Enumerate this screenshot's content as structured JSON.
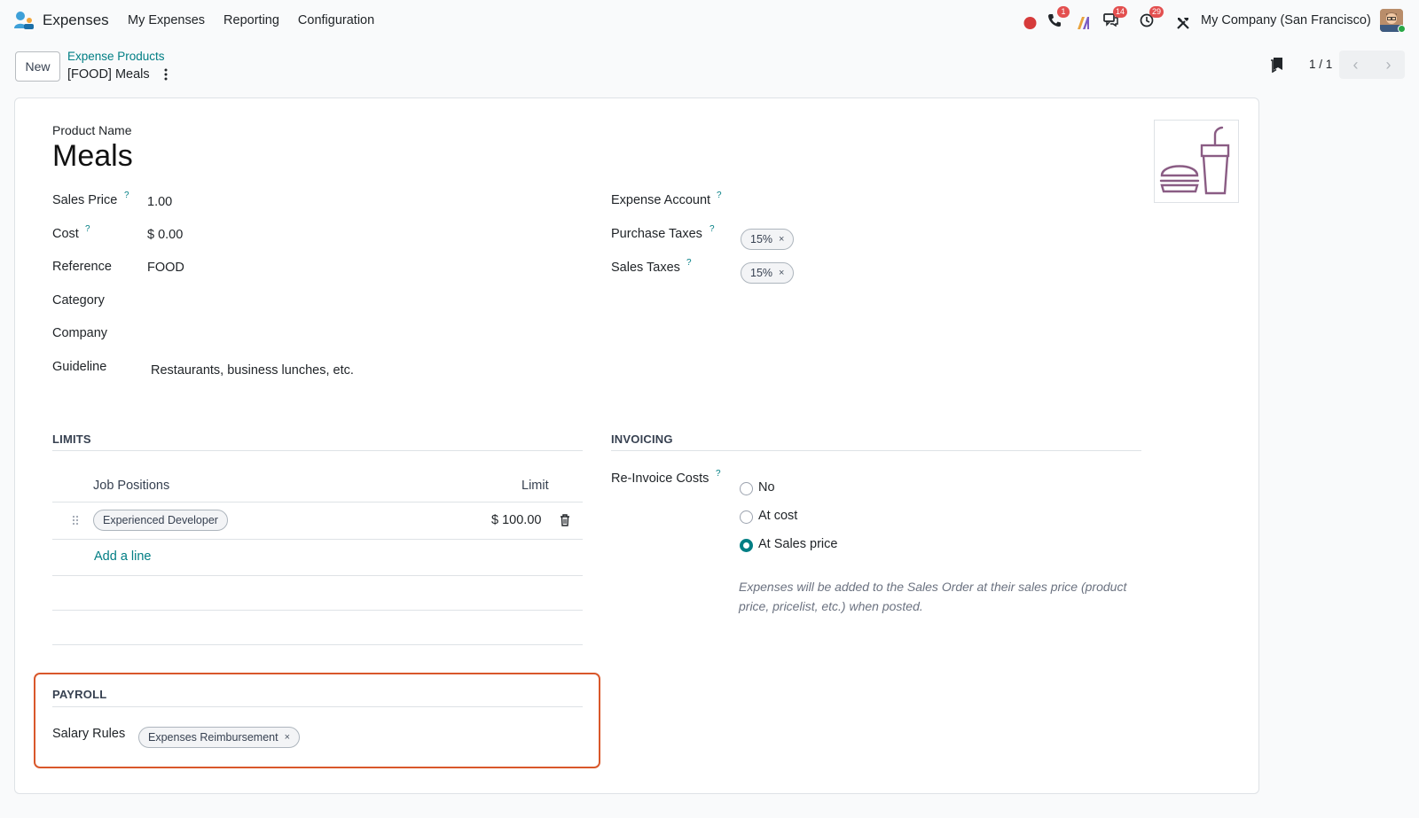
{
  "navbar": {
    "app_name": "Expenses",
    "menu": [
      "My Expenses",
      "Reporting",
      "Configuration"
    ],
    "badges": {
      "calls": "1",
      "messages": "14",
      "activities": "29"
    },
    "company": "My Company (San Francisco)"
  },
  "control_panel": {
    "new_label": "New",
    "breadcrumb_parent": "Expense Products",
    "breadcrumb_current": "[FOOD] Meals",
    "pager_value": "1 / 1"
  },
  "form": {
    "product_name_label": "Product Name",
    "product_name": "Meals",
    "left_fields": [
      {
        "label": "Sales Price",
        "help": "?",
        "value": "1.00"
      },
      {
        "label": "Cost",
        "help": "?",
        "value": "$ 0.00"
      },
      {
        "label": "Reference",
        "help": "",
        "value": "FOOD"
      },
      {
        "label": "Category",
        "help": "",
        "value": ""
      },
      {
        "label": "Company",
        "help": "",
        "value": ""
      },
      {
        "label": "Guideline",
        "help": "",
        "value": "Restaurants, business lunches, etc."
      }
    ],
    "expense_account_label": "Expense Account",
    "purchase_taxes_label": "Purchase Taxes",
    "purchase_taxes_tag": "15%",
    "sales_taxes_label": "Sales Taxes",
    "sales_taxes_tag": "15%",
    "help": "?",
    "tag_remove": "×"
  },
  "limits": {
    "title": "LIMITS",
    "col_job": "Job Positions",
    "col_limit": "Limit",
    "rows": [
      {
        "job": "Experienced Developer",
        "limit": "$ 100.00"
      }
    ],
    "add_line": "Add a line"
  },
  "invoicing": {
    "title": "INVOICING",
    "reinvoice_label": "Re-Invoice Costs",
    "options": [
      "No",
      "At cost",
      "At Sales price"
    ],
    "selected": "At Sales price",
    "note": "Expenses will be added to the Sales Order at their sales price (product price, pricelist, etc.) when posted."
  },
  "payroll": {
    "title": "PAYROLL",
    "salary_rules_label": "Salary Rules",
    "salary_rule_tag": "Expenses Reimbursement"
  },
  "colors": {
    "accent": "#017e84",
    "highlight": "#d9582b",
    "badge": "#e34f4f"
  }
}
